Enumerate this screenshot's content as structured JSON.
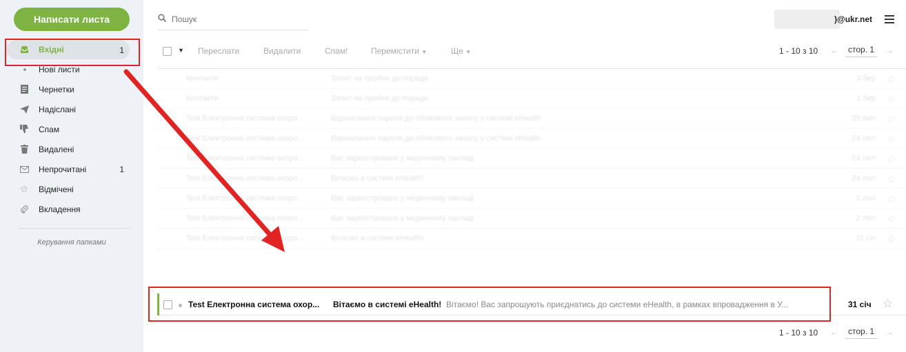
{
  "sidebar": {
    "compose_label": "Написати листа",
    "items": [
      {
        "label": "Вхідні",
        "count": "1",
        "icon": "inbox-icon"
      },
      {
        "label": "Нові листи",
        "icon": "dot"
      },
      {
        "label": "Чернетки",
        "icon": "draft-icon"
      },
      {
        "label": "Надіслані",
        "icon": "send-icon"
      },
      {
        "label": "Спам",
        "icon": "thumbs-down-icon"
      },
      {
        "label": "Видалені",
        "icon": "trash-icon"
      },
      {
        "label": "Непрочитані",
        "count": "1",
        "icon": "envelope-icon"
      },
      {
        "label": "Відмічені",
        "icon": "star-icon"
      },
      {
        "label": "Вкладення",
        "icon": "paperclip-icon"
      }
    ],
    "manage_label": "Керування папками"
  },
  "header": {
    "search_placeholder": "Пошук",
    "user_email": ")@ukr.net"
  },
  "toolbar": {
    "forward": "Переслати",
    "delete": "Видалити",
    "spam": "Спам!",
    "move": "Перемістити",
    "more": "Ще",
    "range": "1 - 10 з 10",
    "page": "стор. 1"
  },
  "messages": [
    {
      "sender": "Контакти",
      "subject": "Запит на пробне до поради.",
      "date": "3 бер"
    },
    {
      "sender": "Контакти",
      "subject": "Запит на пробне до поради.",
      "date": "1 бер"
    },
    {
      "sender": "Test Електронна система охоро...",
      "subject": "Відновлення пароля до облікового запису у системі eHealth",
      "date": "25 лют"
    },
    {
      "sender": "Test Електронна система охоро...",
      "subject": "Відновлення пароля до облікового запису у системі eHealth",
      "date": "24 лют"
    },
    {
      "sender": "Test Електронна система охоро...",
      "subject": "Вас зареєстровано у медичному закладі",
      "date": "24 лют"
    },
    {
      "sender": "Test Електронна система охоро...",
      "subject": "Вітаємо в системі eHealth!",
      "date": "24 лют"
    },
    {
      "sender": "Test Електронна система охоро...",
      "subject": "Вас зареєстровано у медичному закладі",
      "date": "2 лют"
    },
    {
      "sender": "Test Електронна система охоро...",
      "subject": "Вас зареєстровано у медичному закладі",
      "date": "2 лют"
    },
    {
      "sender": "Test Електронна система охоро...",
      "subject": "Вітаємо в системі eHealth!",
      "date": "31 січ"
    }
  ],
  "highlighted": {
    "sender": "Test Електронна система охор...",
    "subject": "Вітаємо в системі eHealth!",
    "preview": "Вітаємо! Вас запрошують приєднатись до системи eHealth, в рамках впровадження в У...",
    "date": "31 січ"
  },
  "bottom_pager": {
    "range": "1 - 10 з 10",
    "page": "стор. 1"
  },
  "annotation_color": "#e02424",
  "accent_color": "#7cb342"
}
